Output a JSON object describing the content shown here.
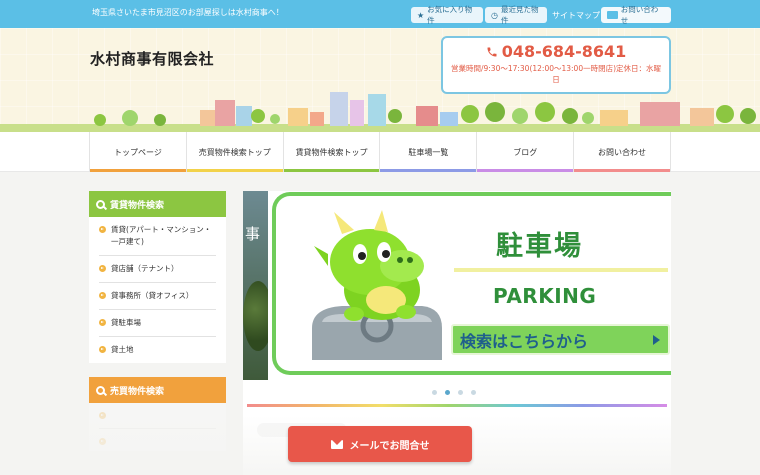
{
  "topbar": {
    "tagline": "埼玉県さいたま市見沼区のお部屋探しは水村商事へ！",
    "favorites_label": "お気に入り物件",
    "recent_label": "最近見た物件",
    "sitemap_label": "サイトマップ",
    "contact_label": "お問い合わせ"
  },
  "header": {
    "company_name": "水村商事有限会社",
    "phone": "048-684-8641",
    "hours": "営業時間/9:30〜17:30(12:00〜13:00一時閉店)定休日：水曜日"
  },
  "nav": {
    "items": [
      {
        "label": "トップページ",
        "color": "#f1a13d"
      },
      {
        "label": "売買物件検索トップ",
        "color": "#f2d24a"
      },
      {
        "label": "賃貸物件検索トップ",
        "color": "#8cc641"
      },
      {
        "label": "駐車場一覧",
        "color": "#8c9ae6"
      },
      {
        "label": "ブログ",
        "color": "#c98ce6"
      },
      {
        "label": "お問い合わせ",
        "color": "#f28c8c"
      }
    ]
  },
  "sidebar": {
    "rental": {
      "title": "賃貸物件検索",
      "items": [
        "賃貸(アパート・マンション・一戸建て)",
        "貸店舗（テナント）",
        "貸事務所（貸オフィス）",
        "貸駐車場",
        "貸土地"
      ]
    },
    "sale": {
      "title": "売買物件検索"
    }
  },
  "slider": {
    "side_text": "事",
    "title": "駐車場",
    "subtitle": "PARKING",
    "button_label": "検索はこちらから",
    "dot_count": 4,
    "active_dot": 2
  },
  "floating": {
    "mail_label": "メールでお問合せ"
  },
  "colors": {
    "topbar": "#5bbfe6",
    "accent_red": "#e8574a",
    "green": "#8cc641",
    "orange": "#f1a13d"
  }
}
